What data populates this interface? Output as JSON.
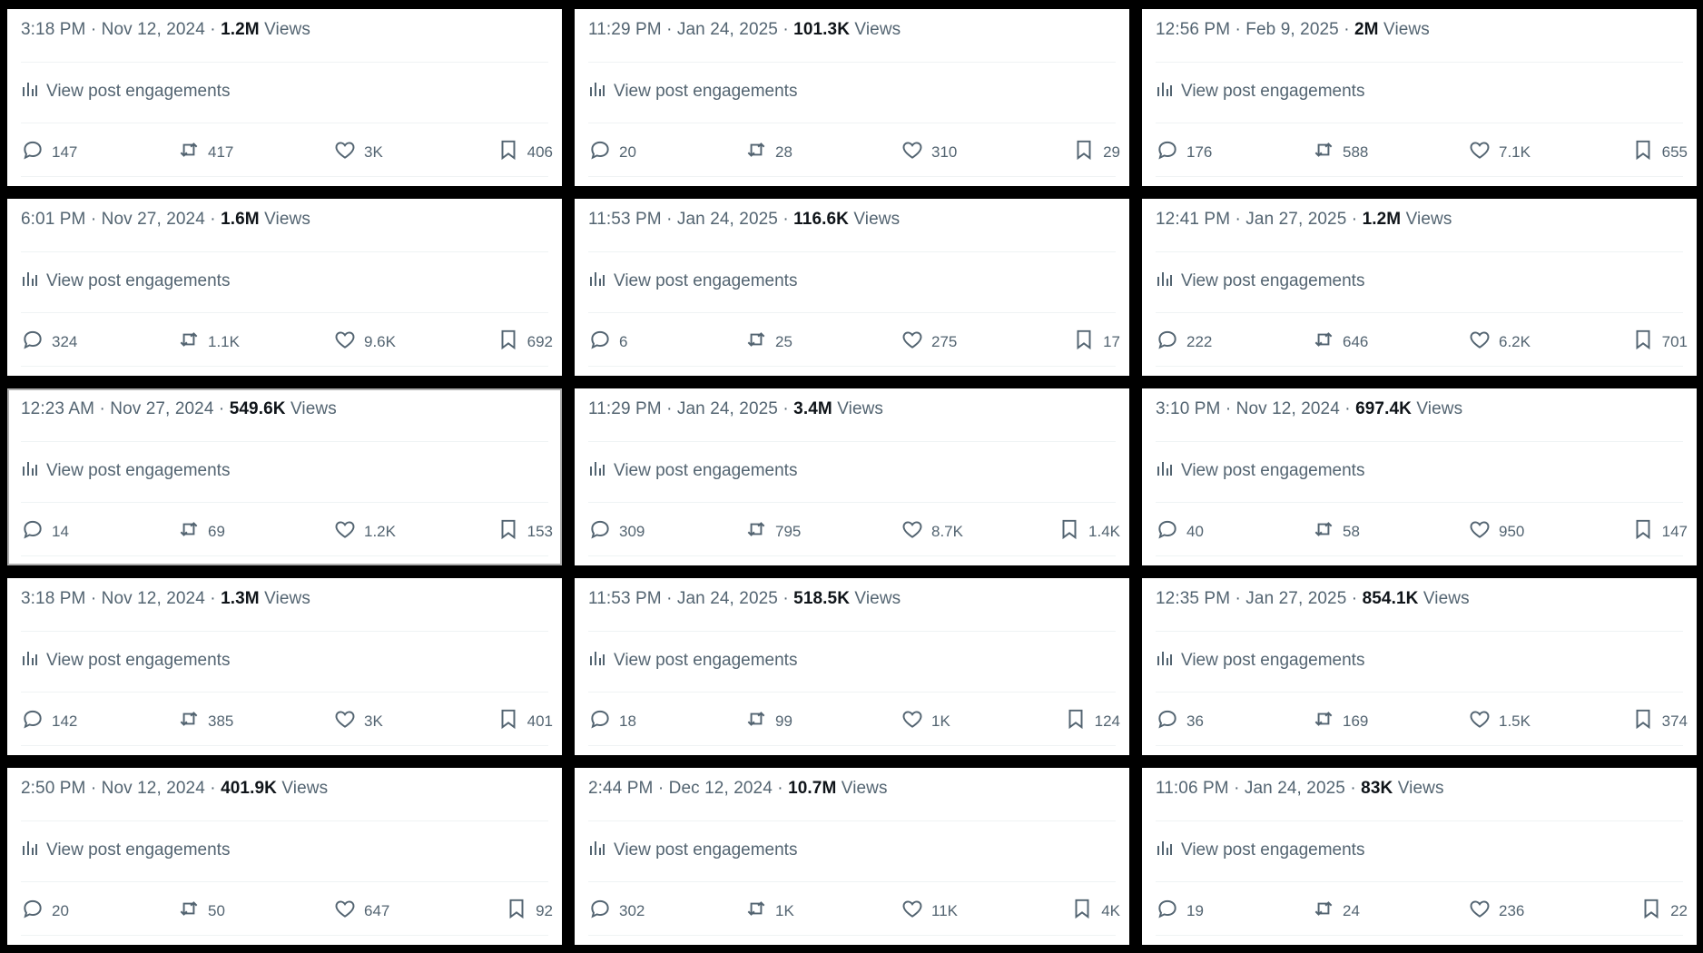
{
  "engagements_label": "View post engagements",
  "views_suffix": "Views",
  "cards": [
    {
      "time": "3:18 PM · Nov 12, 2024 · ",
      "views": "1.2M",
      "replies": "147",
      "reposts": "417",
      "likes": "3K",
      "bookmarks": "406"
    },
    {
      "time": "11:29 PM · Jan 24, 2025 · ",
      "views": "101.3K",
      "replies": "20",
      "reposts": "28",
      "likes": "310",
      "bookmarks": "29"
    },
    {
      "time": "12:56 PM · Feb 9, 2025 · ",
      "views": "2M",
      "replies": "176",
      "reposts": "588",
      "likes": "7.1K",
      "bookmarks": "655"
    },
    {
      "time": "6:01 PM · Nov 27, 2024 · ",
      "views": "1.6M",
      "replies": "324",
      "reposts": "1.1K",
      "likes": "9.6K",
      "bookmarks": "692"
    },
    {
      "time": "11:53 PM · Jan 24, 2025 · ",
      "views": "116.6K",
      "replies": "6",
      "reposts": "25",
      "likes": "275",
      "bookmarks": "17"
    },
    {
      "time": "12:41 PM · Jan 27, 2025 · ",
      "views": "1.2M",
      "replies": "222",
      "reposts": "646",
      "likes": "6.2K",
      "bookmarks": "701"
    },
    {
      "time": "12:23 AM · Nov 27, 2024 · ",
      "views": "549.6K",
      "replies": "14",
      "reposts": "69",
      "likes": "1.2K",
      "bookmarks": "153"
    },
    {
      "time": "11:29 PM · Jan 24, 2025 · ",
      "views": "3.4M",
      "replies": "309",
      "reposts": "795",
      "likes": "8.7K",
      "bookmarks": "1.4K"
    },
    {
      "time": "3:10 PM · Nov 12, 2024 · ",
      "views": "697.4K",
      "replies": "40",
      "reposts": "58",
      "likes": "950",
      "bookmarks": "147"
    },
    {
      "time": "3:18 PM · Nov 12, 2024 · ",
      "views": "1.3M",
      "replies": "142",
      "reposts": "385",
      "likes": "3K",
      "bookmarks": "401"
    },
    {
      "time": "11:53 PM · Jan 24, 2025 · ",
      "views": "518.5K",
      "replies": "18",
      "reposts": "99",
      "likes": "1K",
      "bookmarks": "124"
    },
    {
      "time": "12:35 PM · Jan 27, 2025 · ",
      "views": "854.1K",
      "replies": "36",
      "reposts": "169",
      "likes": "1.5K",
      "bookmarks": "374"
    },
    {
      "time": "2:50 PM · Nov 12, 2024 · ",
      "views": "401.9K",
      "replies": "20",
      "reposts": "50",
      "likes": "647",
      "bookmarks": "92"
    },
    {
      "time": "2:44 PM · Dec 12, 2024 · ",
      "views": "10.7M",
      "replies": "302",
      "reposts": "1K",
      "likes": "11K",
      "bookmarks": "4K"
    },
    {
      "time": "11:06 PM · Jan 24, 2025 · ",
      "views": "83K",
      "replies": "19",
      "reposts": "24",
      "likes": "236",
      "bookmarks": "22"
    }
  ]
}
